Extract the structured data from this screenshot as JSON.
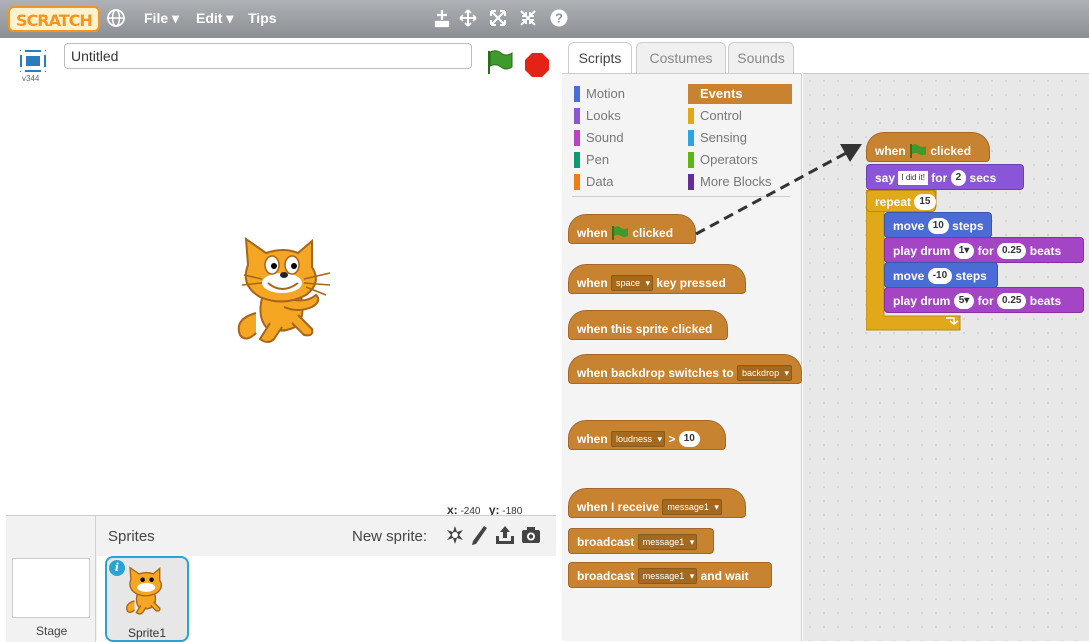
{
  "menubar": {
    "logo": "SCRATCH",
    "items": [
      "File ▾",
      "Edit ▾",
      "Tips"
    ],
    "icons": [
      "globe-icon",
      "duplicate-icon",
      "cut-icon",
      "grow-icon",
      "shrink-icon",
      "help-icon"
    ]
  },
  "project": {
    "title": "Untitled",
    "version": "v344"
  },
  "stage": {
    "x_label": "x:",
    "x_value": "-240",
    "y_label": "y:",
    "y_value": "-180"
  },
  "sprite_pane": {
    "sprites_label": "Sprites",
    "new_sprite_label": "New sprite:",
    "stage_label": "Stage",
    "sprite_name": "Sprite1",
    "info_glyph": "i"
  },
  "tabs": [
    {
      "label": "Scripts",
      "active": true
    },
    {
      "label": "Costumes",
      "active": false
    },
    {
      "label": "Sounds",
      "active": false
    }
  ],
  "categories": {
    "left": [
      {
        "label": "Motion",
        "color": "#4a6cd4"
      },
      {
        "label": "Looks",
        "color": "#8a55d7"
      },
      {
        "label": "Sound",
        "color": "#bb42c3"
      },
      {
        "label": "Pen",
        "color": "#0e9a6c"
      },
      {
        "label": "Data",
        "color": "#ee7d16"
      }
    ],
    "right": [
      {
        "label": "Events",
        "color": "#c88330",
        "selected": true
      },
      {
        "label": "Control",
        "color": "#e1a91a"
      },
      {
        "label": "Sensing",
        "color": "#2ca5e2"
      },
      {
        "label": "Operators",
        "color": "#5cb712"
      },
      {
        "label": "More Blocks",
        "color": "#632d99"
      }
    ]
  },
  "palette_blocks": {
    "when_flag": {
      "when": "when",
      "clicked": "clicked"
    },
    "when_key": {
      "when": "when",
      "key": "space",
      "pressed": "key pressed"
    },
    "when_sprite": {
      "label": "when this sprite clicked"
    },
    "when_backdrop": {
      "label": "when backdrop switches to",
      "value": "backdrop"
    },
    "when_loudness": {
      "when": "when",
      "sensor": "loudness",
      "op": ">",
      "value": "10"
    },
    "when_receive": {
      "label": "when I receive",
      "value": "message1"
    },
    "broadcast": {
      "label": "broadcast",
      "value": "message1"
    },
    "broadcast_wait": {
      "label": "broadcast",
      "value": "message1",
      "tail": "and wait"
    }
  },
  "script": {
    "hat": {
      "when": "when",
      "clicked": "clicked"
    },
    "say": {
      "label": "say",
      "text": "I did it!",
      "for": "for",
      "secs_value": "2",
      "secs": "secs"
    },
    "repeat": {
      "label": "repeat",
      "value": "15"
    },
    "move1": {
      "label": "move",
      "value": "10",
      "steps": "steps"
    },
    "drum1": {
      "label": "play drum",
      "drum": "1▾",
      "for": "for",
      "beats_value": "0.25",
      "beats": "beats"
    },
    "move2": {
      "label": "move",
      "value": "-10",
      "steps": "steps"
    },
    "drum2": {
      "label": "play drum",
      "drum": "5▾",
      "for": "for",
      "beats_value": "0.25",
      "beats": "beats"
    }
  },
  "colors": {
    "events": "#c88330",
    "control": "#e1a91a",
    "looks": "#8a55d7",
    "motion": "#4a6cd4",
    "sound": "#a345c4",
    "accent": "#29a3d6"
  }
}
